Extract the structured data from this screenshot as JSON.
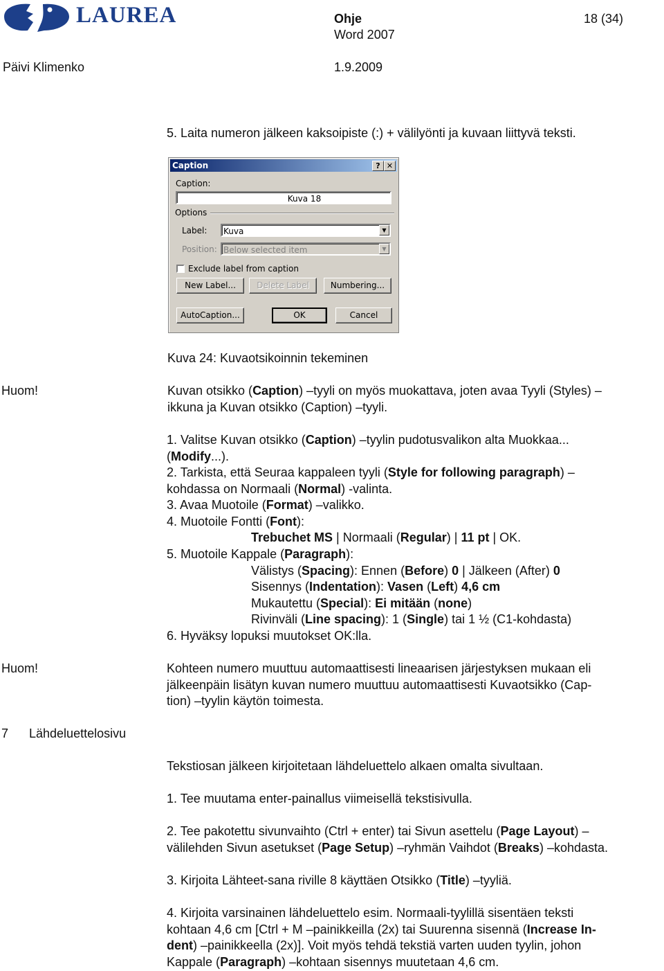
{
  "header": {
    "logo_text": "LAUREA",
    "doc_title": "Ohje",
    "doc_subtitle": "Word 2007",
    "page_number": "18 (34)",
    "author": "Päivi Klimenko",
    "date": "1.9.2009",
    "brand_color": "#1d3f8a"
  },
  "step5_intro": "5. Laita numeron jälkeen kaksoipiste (:) + välilyönti ja kuvaan liittyvä teksti.",
  "dialog": {
    "title": "Caption",
    "help_button": "?",
    "close_button": "✕",
    "caption_label": "Caption:",
    "caption_value": "Kuva 18",
    "options_label": "Options",
    "label_label": "Label:",
    "label_value": "Kuva",
    "position_label": "Position:",
    "position_value": "Below selected item",
    "exclude_label": "Exclude label from caption",
    "exclude_checked": false,
    "buttons": {
      "new_label": "New Label...",
      "delete_label": "Delete Label",
      "numbering": "Numbering...",
      "autocaption": "AutoCaption...",
      "ok": "OK",
      "cancel": "Cancel"
    }
  },
  "figure_caption": "Kuva 24: Kuvaotsikoinnin tekeminen",
  "note1": {
    "label": "Huom!",
    "line1": [
      "Kuvan otsikko (",
      "Caption",
      ") –tyyli on myös muokattava, joten avaa Tyyli (Styles) –"
    ],
    "line2": "ikkuna ja Kuvan otsikko (Caption) –tyyli."
  },
  "steps": {
    "s1a": [
      "1. Valitse Kuvan otsikko (",
      "Caption",
      ") –tyylin pudotusvalikon alta Muokkaa..."
    ],
    "s1b": [
      "(",
      "Modify",
      "...)."
    ],
    "s2a": [
      "2. Tarkista, että Seuraa kappaleen tyyli (",
      "Style for following paragraph",
      ") –"
    ],
    "s2b": [
      "kohdassa on Normaali (",
      "Normal",
      ") -valinta."
    ],
    "s3": [
      "3. Avaa Muotoile (",
      "Format",
      ") –valikko."
    ],
    "s4": [
      "4. Muotoile Fontti (",
      "Font",
      "):"
    ],
    "s4_detail": [
      "Trebuchet MS",
      " | Normaali (",
      "Regular",
      ") | ",
      "11 pt",
      " | OK."
    ],
    "s5": [
      "5. Muotoile Kappale (",
      "Paragraph",
      "):"
    ],
    "s5_spacing": [
      "Välistys (",
      "Spacing",
      "): Ennen (",
      "Before",
      ") ",
      "0",
      " | Jälkeen (After) ",
      "0"
    ],
    "s5_indent": [
      "Sisennys (",
      "Indentation",
      "): ",
      "Vasen",
      " (",
      "Left",
      ") ",
      "4,6 cm"
    ],
    "s5_special": [
      "Mukautettu (",
      "Special",
      "): ",
      "Ei mitään",
      " (",
      "none",
      ")"
    ],
    "s5_linespacing": [
      "Rivinväli (",
      "Line spacing",
      "): 1 (",
      "Single",
      ") tai 1 ½ (C1-kohdasta)"
    ],
    "s6": "6. Hyväksy lopuksi muutokset OK:lla."
  },
  "note2": {
    "label": "Huom!",
    "line1": "Kohteen numero muuttuu automaattisesti lineaarisen järjestyksen mukaan eli",
    "line2": "jälkeenpäin lisätyn kuvan numero muuttuu automaattisesti Kuvaotsikko (Cap-",
    "line3": "tion) –tyylin käytön toimesta."
  },
  "section7": {
    "number": "7",
    "title": "Lähdeluettelosivu",
    "intro": "Tekstiosan jälkeen kirjoitetaan lähdeluettelo alkaen omalta sivultaan.",
    "p1": "1. Tee muutama enter-painallus viimeisellä tekstisivulla.",
    "p2a": [
      "2. Tee pakotettu sivunvaihto (Ctrl + enter) tai Sivun asettelu (",
      "Page Layout",
      ") –"
    ],
    "p2b": [
      "välilehden Sivun asetukset (",
      "Page Setup",
      ") –ryhmän Vaihdot (",
      "Breaks",
      ") –kohdasta."
    ],
    "p3": [
      "3. Kirjoita Lähteet-sana riville 8 käyttäen Otsikko (",
      "Title",
      ") –tyyliä."
    ],
    "p4a": "4. Kirjoita varsinainen lähdeluettelo esim. Normaali-tyylillä sisentäen teksti",
    "p4b": [
      "kohtaan 4,6 cm [Ctrl + M –painikkeilla (2x) tai Suurenna sisennä (",
      "Increase In-"
    ],
    "p4c": [
      "dent",
      ") –painikkeella (2x)]. Voit myös tehdä tekstiä varten uuden tyylin, johon"
    ],
    "p4d": [
      "Kappale (",
      "Paragraph",
      ") –kohtaan sisennys muutetaan 4,6 cm."
    ]
  }
}
